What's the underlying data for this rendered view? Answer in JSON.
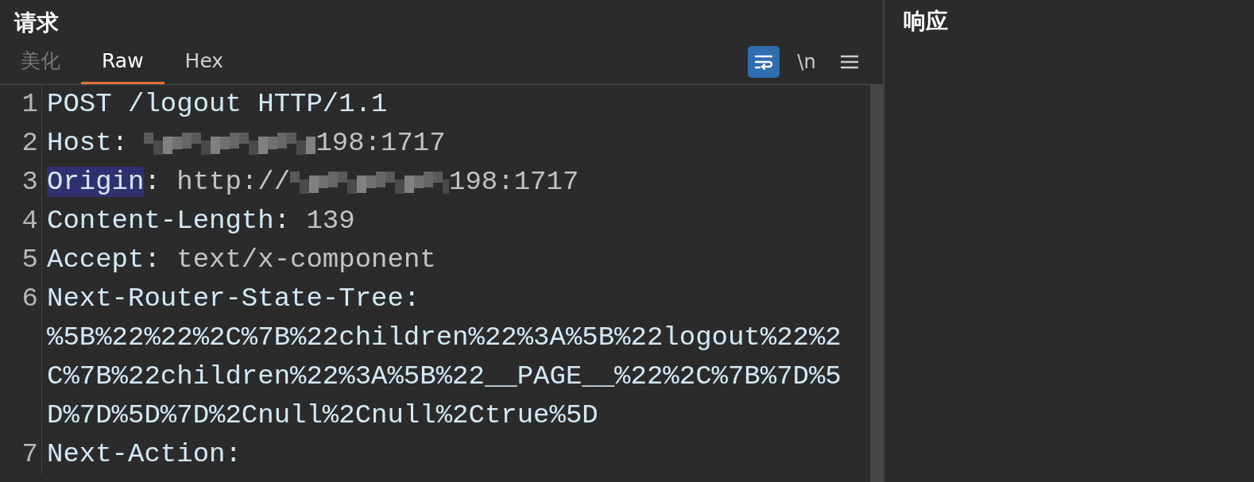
{
  "request": {
    "title": "请求",
    "tabs": [
      {
        "label": "美化",
        "selected": false,
        "disabled": true
      },
      {
        "label": "Raw",
        "selected": true,
        "disabled": false
      },
      {
        "label": "Hex",
        "selected": false,
        "disabled": false
      }
    ],
    "toolbar": [
      {
        "kind": "wrap",
        "on": true
      },
      {
        "kind": "newline",
        "label": "\\n",
        "on": false
      },
      {
        "kind": "menu"
      }
    ],
    "lines": [
      {
        "number": "1",
        "name": "POST /logout HTTP/1.1",
        "highlighted": false
      },
      {
        "number": "2",
        "name": "Host",
        "separator": ":",
        "highlighted": false,
        "parts": [
          {
            "kind": "redacted"
          },
          {
            "kind": "text",
            "text": "198:1717"
          }
        ]
      },
      {
        "number": "3",
        "name": "Origin",
        "separator": ":",
        "highlighted": true,
        "parts": [
          {
            "kind": "text",
            "text": "http://"
          },
          {
            "kind": "redacted"
          },
          {
            "kind": "text",
            "text": "198:1717"
          }
        ]
      },
      {
        "number": "4",
        "name": "Content-Length",
        "separator": ":",
        "highlighted": false,
        "parts": [
          {
            "kind": "text",
            "text": "139"
          }
        ]
      },
      {
        "number": "5",
        "name": "Accept",
        "separator": ":",
        "highlighted": false,
        "parts": [
          {
            "kind": "text",
            "text": "text/x-component"
          }
        ]
      },
      {
        "number": "6",
        "name": "Next-Router-State-Tree",
        "separator": ":",
        "highlighted": false,
        "parts": [
          {
            "kind": "wrapped",
            "text": "%5B%22%22%2C%7B%22children%22%3A%5B%22logout%22%2C%7B%22children%22%3A%5B%22__PAGE__%22%2C%7B%7D%5D%7D%5D%7D%2Cnull%2Cnull%2Ctrue%5D"
          }
        ]
      },
      {
        "number": "7",
        "name": "Next-Action",
        "separator": ":",
        "highlighted": false
      }
    ]
  },
  "response": {
    "title": "响应"
  }
}
